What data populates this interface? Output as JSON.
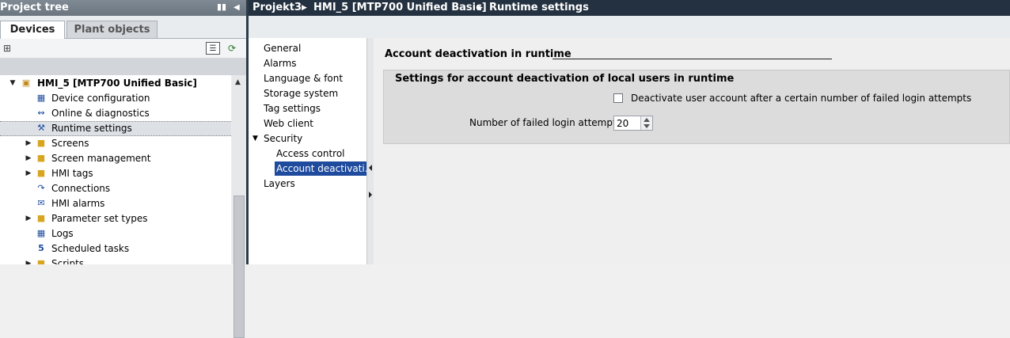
{
  "project_tree": {
    "title": "Project tree",
    "pin_icon": "pin-icon",
    "collapse_icon": "collapse-left-icon",
    "tabs": [
      {
        "label": "Devices",
        "active": true
      },
      {
        "label": "Plant objects",
        "active": false
      }
    ],
    "items": [
      {
        "label": "HMI_5 [MTP700 Unified Basic]",
        "icon": "hmi-device-icon",
        "expanded": true,
        "root": true
      },
      {
        "label": "Device configuration",
        "icon": "device-config-icon"
      },
      {
        "label": "Online & diagnostics",
        "icon": "online-diagnostics-icon"
      },
      {
        "label": "Runtime settings",
        "icon": "runtime-settings-icon",
        "selected": true
      },
      {
        "label": "Screens",
        "icon": "folder-icon",
        "collapsed": true
      },
      {
        "label": "Screen management",
        "icon": "folder-icon",
        "collapsed": true
      },
      {
        "label": "HMI tags",
        "icon": "folder-icon",
        "collapsed": true
      },
      {
        "label": "Connections",
        "icon": "connections-icon"
      },
      {
        "label": "HMI alarms",
        "icon": "alarms-icon"
      },
      {
        "label": "Parameter set types",
        "icon": "folder-icon",
        "collapsed": true
      },
      {
        "label": "Logs",
        "icon": "logs-icon"
      },
      {
        "label": "Scheduled tasks",
        "icon": "scheduled-tasks-icon"
      },
      {
        "label": "Scripts",
        "icon": "folder-icon",
        "collapsed": true
      }
    ]
  },
  "editor": {
    "breadcrumb": [
      "Projekt3",
      "HMI_5 [MTP700 Unified Basic]",
      "Runtime settings"
    ],
    "nav": {
      "items": [
        {
          "label": "General"
        },
        {
          "label": "Alarms"
        },
        {
          "label": "Language & font"
        },
        {
          "label": "Storage system"
        },
        {
          "label": "Tag settings"
        },
        {
          "label": "Web client"
        },
        {
          "label": "Security",
          "expanded": true
        },
        {
          "label": "Access control",
          "child": true
        },
        {
          "label": "Account deactivati...",
          "child": true,
          "active": true
        },
        {
          "label": "Layers"
        }
      ]
    },
    "content": {
      "section_title": "Account deactivation in runtime",
      "group_title": "Settings for account deactivation of local users in runtime",
      "checkbox_label": "Deactivate user account after a certain number of failed login attempts",
      "checkbox_checked": false,
      "attempts_label": "Number of failed login attempts:",
      "attempts_value": "20"
    }
  },
  "colors": {
    "title_bar": "#243140",
    "selection": "#1e4b9e",
    "tree_background": "#ffffff"
  }
}
